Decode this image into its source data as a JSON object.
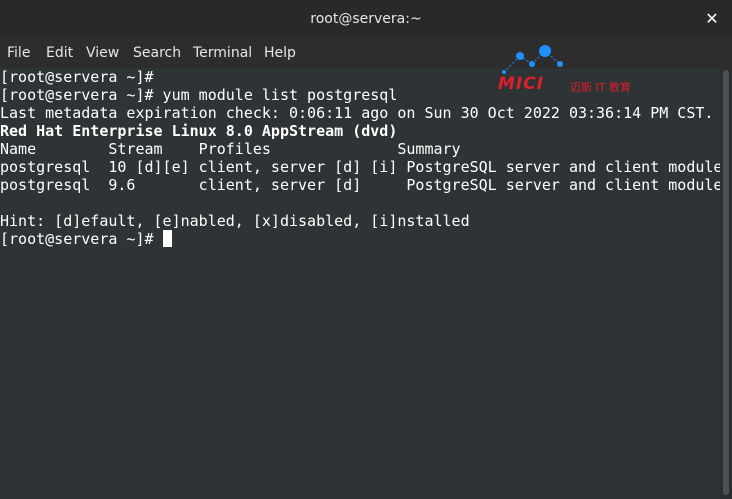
{
  "window": {
    "title": "root@servera:~",
    "close_glyph": "✕"
  },
  "menu": {
    "items": [
      {
        "label": "File"
      },
      {
        "label": "Edit"
      },
      {
        "label": "View"
      },
      {
        "label": "Search"
      },
      {
        "label": "Terminal"
      },
      {
        "label": "Help"
      }
    ]
  },
  "watermark": {
    "brand": "MICI",
    "tagline": "迈斯 IT 教育",
    "color": "#e01e2b",
    "dot_color": "#1e90ff"
  },
  "terminal": {
    "lines": [
      {
        "text": "[root@servera ~]#"
      },
      {
        "text": "[root@servera ~]# yum module list postgresql"
      },
      {
        "text": "Last metadata expiration check: 0:06:11 ago on Sun 30 Oct 2022 03:36:14 PM CST."
      },
      {
        "text": "Red Hat Enterprise Linux 8.0 AppStream (dvd)"
      },
      {
        "text": "Name        Stream    Profiles              Summary"
      },
      {
        "text": "postgresql  10 [d][e] client, server [d] [i] PostgreSQL server and client module"
      },
      {
        "text": "postgresql  9.6       client, server [d]     PostgreSQL server and client module"
      },
      {
        "text": ""
      },
      {
        "text": "Hint: [d]efault, [e]nabled, [x]disabled, [i]nstalled"
      },
      {
        "text": "[root@servera ~]# "
      }
    ],
    "colors": {
      "background": "#2e3436",
      "foreground": "#ffffff"
    }
  }
}
